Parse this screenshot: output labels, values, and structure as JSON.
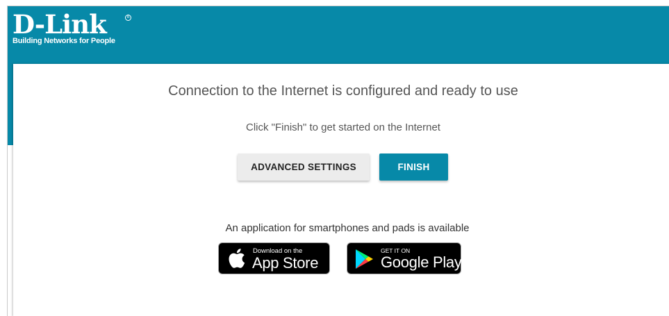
{
  "brand": {
    "name": "D-Link",
    "tagline": "Building Networks for People",
    "trademark": "R"
  },
  "main": {
    "title": "Connection to the Internet is configured and ready to use",
    "subtitle": "Click \"Finish\" to get started on the Internet",
    "buttons": {
      "advanced_label": "ADVANCED SETTINGS",
      "finish_label": "FINISH"
    },
    "app_text": "An application for smartphones and pads is available",
    "app_store": {
      "small": "Download on the",
      "big": "App Store",
      "icon": "apple-icon"
    },
    "google_play": {
      "small": "GET IT ON",
      "big": "Google Play",
      "icon": "google-play-icon"
    }
  },
  "colors": {
    "accent": "#0789a8",
    "button_secondary": "#ececec",
    "text": "#555555"
  }
}
